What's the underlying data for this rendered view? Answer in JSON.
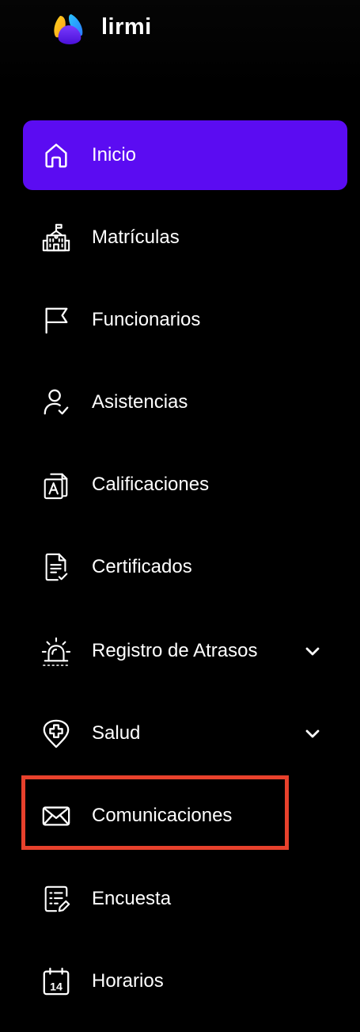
{
  "brand": {
    "name": "lirmi"
  },
  "nav": {
    "items": [
      {
        "label": "Inicio",
        "icon": "home-icon",
        "active": true
      },
      {
        "label": "Matrículas",
        "icon": "school-building-icon"
      },
      {
        "label": "Funcionarios",
        "icon": "flag-icon"
      },
      {
        "label": "Asistencias",
        "icon": "user-check-icon"
      },
      {
        "label": "Calificaciones",
        "icon": "grade-document-icon"
      },
      {
        "label": "Certificados",
        "icon": "certificate-document-icon"
      },
      {
        "label": "Registro de Atrasos",
        "icon": "alarm-siren-icon",
        "expandable": true
      },
      {
        "label": "Salud",
        "icon": "health-shield-icon",
        "expandable": true
      },
      {
        "label": "Comunicaciones",
        "icon": "mail-icon",
        "highlighted": true
      },
      {
        "label": "Encuesta",
        "icon": "survey-icon"
      },
      {
        "label": "Horarios",
        "icon": "calendar-14-icon",
        "calendar_day": "14"
      }
    ]
  },
  "colors": {
    "background": "#000000",
    "active": "#5b0cf2",
    "highlight_border": "#e8412c",
    "text": "#ffffff"
  }
}
